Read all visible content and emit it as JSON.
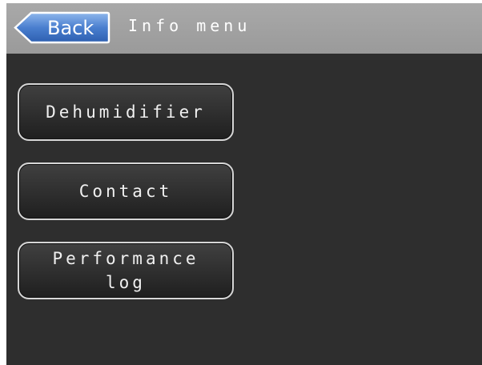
{
  "header": {
    "back_label": "Back",
    "title": "Info menu"
  },
  "menu": {
    "items": [
      {
        "label": "Dehumidifier"
      },
      {
        "label": "Contact"
      },
      {
        "label": "Performance\nlog"
      }
    ]
  },
  "colors": {
    "header_background": "#a0a0a0",
    "screen_background": "#2e2e2e",
    "back_button_blue": "#4a7fcf",
    "button_border": "#d6d6d6",
    "text": "#ffffff"
  },
  "icons": {
    "back": "left-arrow-icon"
  }
}
